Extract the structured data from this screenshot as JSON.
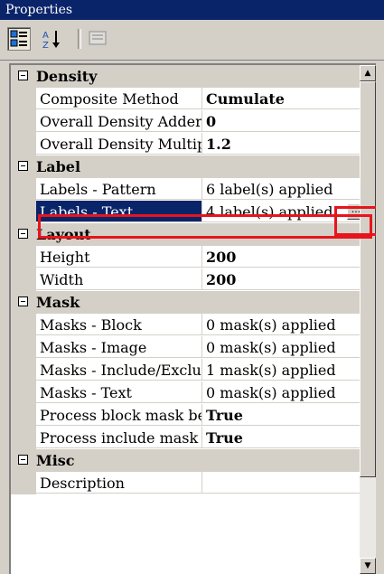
{
  "window": {
    "title": "Properties"
  },
  "toolbar": {
    "buttons": [
      {
        "name": "categorized",
        "icon": "categorized-icon",
        "pressed": true
      },
      {
        "name": "alphabetical",
        "icon": "sort-az-icon",
        "pressed": false
      },
      {
        "name": "property-pages",
        "icon": "property-pages-icon",
        "enabled": false
      }
    ]
  },
  "grid": {
    "categories": [
      {
        "label": "Density",
        "items": [
          {
            "name": "Composite Method",
            "value": "Cumulate",
            "bold": true
          },
          {
            "name": "Overall Density Adder",
            "value": "0",
            "bold": true
          },
          {
            "name": "Overall Density Multip",
            "value": "1.2",
            "bold": true
          }
        ]
      },
      {
        "label": "Label",
        "items": [
          {
            "name": "Labels - Pattern",
            "value": "6 label(s) applied",
            "bold": false
          },
          {
            "name": "Labels - Text",
            "value": "4 label(s) applied",
            "bold": false,
            "selected": true,
            "ellipsis": "..."
          }
        ]
      },
      {
        "label": "Layout",
        "items": [
          {
            "name": "Height",
            "value": "200",
            "bold": true
          },
          {
            "name": "Width",
            "value": "200",
            "bold": true
          }
        ]
      },
      {
        "label": "Mask",
        "items": [
          {
            "name": "Masks - Block",
            "value": "0 mask(s) applied",
            "bold": false
          },
          {
            "name": "Masks - Image",
            "value": "0 mask(s) applied",
            "bold": false
          },
          {
            "name": "Masks - Include/Exclu",
            "value": "1 mask(s) applied",
            "bold": false
          },
          {
            "name": "Masks - Text",
            "value": "0 mask(s) applied",
            "bold": false
          },
          {
            "name": "Process block mask be",
            "value": "True",
            "bold": true
          },
          {
            "name": "Process include mask",
            "value": "True",
            "bold": true
          }
        ]
      },
      {
        "label": "Misc",
        "items": [
          {
            "name": "Description",
            "value": "",
            "bold": false
          }
        ]
      }
    ]
  },
  "colors": {
    "selection": "#0a246a",
    "highlight": "#e8141c",
    "chrome": "#d4d0c8"
  }
}
